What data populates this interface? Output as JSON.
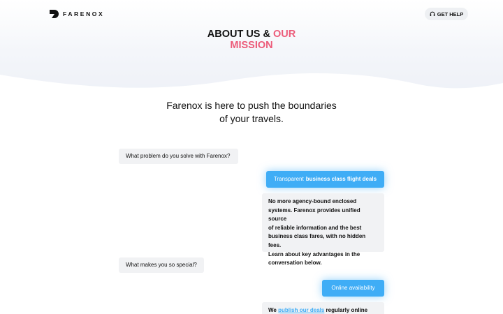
{
  "header": {
    "logo_text": "FARENOX",
    "help_label": "GET HELP"
  },
  "title": {
    "part1": "ABOUT US & ",
    "part2": "OUR",
    "line2": "MISSION"
  },
  "tagline": {
    "line1": "Farenox is here to push the boundaries",
    "line2": "of your travels."
  },
  "chat": {
    "q1": "What problem do you solve with Farenox?",
    "a1_prefix": "Transparent",
    "a1_bold": "business class flight deals",
    "m1_lines": [
      "No more agency-bound enclosed",
      "systems. Farenox provides unified source",
      "of reliable information and the best",
      "business class fares, with no hidden fees.",
      "Learn about key advantages in the",
      "conversation below."
    ],
    "q2": "What makes you so special?",
    "a2": "Online availability",
    "m2_prefix": "We ",
    "m2_link": "publish our deals",
    "m2_suffix": " regularly online"
  },
  "colors": {
    "accent_pink": "#ec5b79",
    "accent_blue": "#3fadf6",
    "bubble_gray": "#f1f2f4"
  }
}
